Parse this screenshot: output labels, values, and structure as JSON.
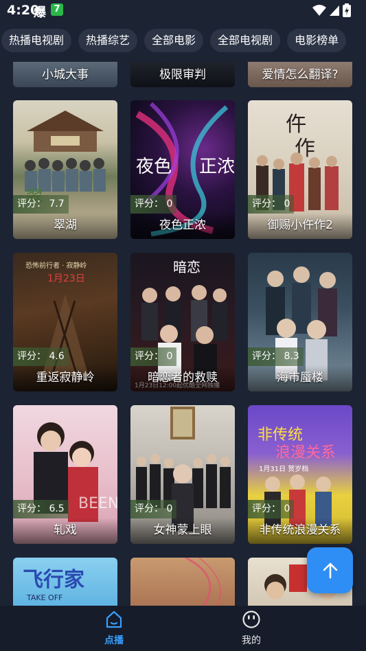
{
  "status_bar": {
    "time": "4:20",
    "app_icon_1": "爆",
    "app_icon_2": "7",
    "icons": [
      "wifi-icon",
      "signal-icon",
      "battery-icon"
    ]
  },
  "tabs": [
    "热播电视剧",
    "热播综艺",
    "全部电影",
    "全部电视剧",
    "电影榜单"
  ],
  "score_prefix": "评分：",
  "top_row": [
    {
      "title": "小城大事"
    },
    {
      "title": "极限审判"
    },
    {
      "title": "爱情怎么翻译?"
    }
  ],
  "cards": [
    {
      "title": "翠湖",
      "score": "7.7"
    },
    {
      "title": "夜色正浓",
      "score": "0"
    },
    {
      "title": "御赐小仵作2",
      "score": "0"
    },
    {
      "title": "重返寂静岭",
      "score": "4.6"
    },
    {
      "title": "暗恋者的救赎",
      "score": "0"
    },
    {
      "title": "海市蜃楼",
      "score": "8.3"
    },
    {
      "title": "轧戏",
      "score": "6.5"
    },
    {
      "title": "女神蒙上眼",
      "score": "0"
    },
    {
      "title": "非传统浪漫关系",
      "score": "0"
    }
  ],
  "bottom_row": [
    {
      "title": ""
    },
    {
      "title": ""
    },
    {
      "title": ""
    }
  ],
  "fab": {
    "icon": "arrow-up-icon"
  },
  "bottom_nav": {
    "home_label": "点播",
    "mine_label": "我的"
  },
  "colors": {
    "background": "#1c2333",
    "tab_bg": "#2c3446",
    "accent": "#3aa0ff",
    "fab": "#2f8ef5"
  }
}
